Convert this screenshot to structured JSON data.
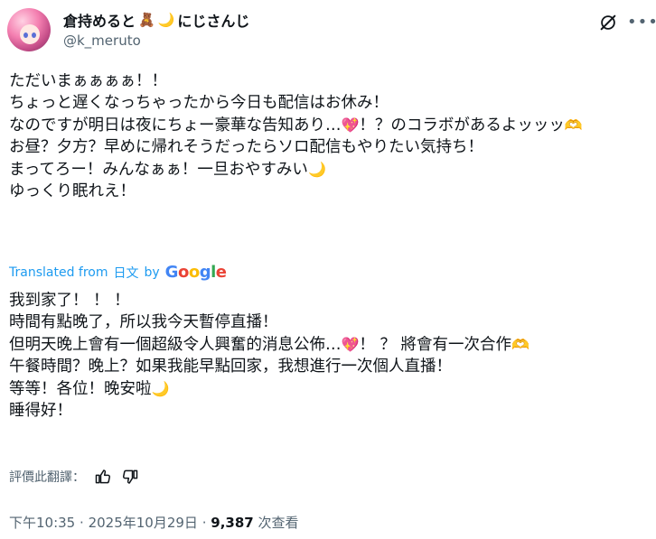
{
  "user": {
    "display_name": "倉持めると",
    "name_emoji_1": "🧸",
    "name_emoji_2": "🌙",
    "name_suffix": "にじさんじ",
    "handle": "@k_meruto",
    "avatar_icon": "avatar-anime-girl-pink-hair"
  },
  "original": {
    "line1": "ただいまぁぁぁぁ！！",
    "line2": "ちょっと遅くなっちゃったから今日も配信はお休み！",
    "line3_a": "なのですが明日は夜にちょー豪華な告知あり…",
    "line3_b": "！？のコラボがあるよッッッ",
    "line4": "お昼？夕方？早めに帰れそうだったらソロ配信もやりたい気持ち！",
    "line5": "まってろー！みんなぁぁ！一旦おやすみい",
    "line6": "ゆっくり眠れえ！"
  },
  "translation": {
    "prefix": "Translated from",
    "lang": "日文",
    "by": "by",
    "provider": "Google",
    "line1": "我到家了！ ！ ！",
    "line2": "時間有點晚了，所以我今天暫停直播！",
    "line3_a": "但明天晚上會有一個超級令人興奮的消息公佈…",
    "line3_b": "！ ？ 將會有一次合作",
    "line4": "午餐時間？晚上？如果我能早點回家，我想進行一次個人直播！",
    "line5": "等等！各位！晚安啦",
    "line6": "睡得好！"
  },
  "emojis": {
    "sparkle_heart": "💖",
    "heart_hands": "🫶",
    "moon": "🌙"
  },
  "rating": {
    "label": "評價此翻譯："
  },
  "meta": {
    "time": "下午10:35",
    "sep1": "·",
    "date": "2025年10月29日",
    "sep2": "·",
    "views": "9,387",
    "views_label": "次查看"
  },
  "colors": {
    "link": "#1d9bf0",
    "secondary": "#536471",
    "text": "#0f1419"
  }
}
